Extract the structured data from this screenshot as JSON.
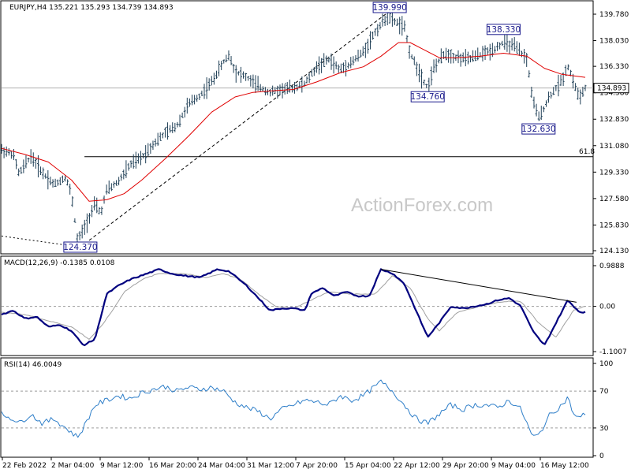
{
  "colors": {
    "price_bars": "#1f3f56",
    "ma_line": "#e00000",
    "trendline": "#000000",
    "fib_line": "#000000",
    "hline": "#b0b0b0",
    "callout_border": "#1a1a8c",
    "macd_line": "#00007f",
    "macd_signal": "#a0a0a0",
    "rsi_line": "#2f7fc9",
    "grid_dash": "#9a9a9a",
    "panel_border": "#000000"
  },
  "chart_data": [
    {
      "type": "line",
      "panel": "price",
      "header": "EURJPY,H4  135.221 135.293 134.739 134.893",
      "watermark": "ActionForex.com",
      "y_ticks": [
        "139.780",
        "138.030",
        "136.330",
        "134.580",
        "132.830",
        "131.080",
        "129.330",
        "127.580",
        "125.830",
        "124.130"
      ],
      "ylim": [
        124.13,
        139.78
      ],
      "last_price": "134.893",
      "close_path": [
        {
          "x": 0,
          "v": 130.8
        },
        {
          "x": 0.02,
          "v": 130.5
        },
        {
          "x": 0.03,
          "v": 129.2
        },
        {
          "x": 0.05,
          "v": 130.4
        },
        {
          "x": 0.07,
          "v": 129.3
        },
        {
          "x": 0.09,
          "v": 128.5
        },
        {
          "x": 0.11,
          "v": 129.0
        },
        {
          "x": 0.12,
          "v": 127.8
        },
        {
          "x": 0.13,
          "v": 124.8
        },
        {
          "x": 0.14,
          "v": 125.5
        },
        {
          "x": 0.16,
          "v": 127.2
        },
        {
          "x": 0.17,
          "v": 126.6
        },
        {
          "x": 0.18,
          "v": 128.1
        },
        {
          "x": 0.2,
          "v": 128.7
        },
        {
          "x": 0.22,
          "v": 129.8
        },
        {
          "x": 0.24,
          "v": 130.3
        },
        {
          "x": 0.26,
          "v": 131.2
        },
        {
          "x": 0.28,
          "v": 131.9
        },
        {
          "x": 0.3,
          "v": 132.4
        },
        {
          "x": 0.32,
          "v": 133.8
        },
        {
          "x": 0.34,
          "v": 134.4
        },
        {
          "x": 0.36,
          "v": 135.3
        },
        {
          "x": 0.38,
          "v": 136.6
        },
        {
          "x": 0.39,
          "v": 137.1
        },
        {
          "x": 0.4,
          "v": 136.0
        },
        {
          "x": 0.42,
          "v": 135.6
        },
        {
          "x": 0.44,
          "v": 135.0
        },
        {
          "x": 0.46,
          "v": 134.6
        },
        {
          "x": 0.48,
          "v": 134.8
        },
        {
          "x": 0.5,
          "v": 134.9
        },
        {
          "x": 0.52,
          "v": 135.2
        },
        {
          "x": 0.54,
          "v": 136.3
        },
        {
          "x": 0.56,
          "v": 136.8
        },
        {
          "x": 0.58,
          "v": 136.1
        },
        {
          "x": 0.6,
          "v": 136.6
        },
        {
          "x": 0.62,
          "v": 137.3
        },
        {
          "x": 0.64,
          "v": 138.6
        },
        {
          "x": 0.66,
          "v": 139.6
        },
        {
          "x": 0.67,
          "v": 139.4
        },
        {
          "x": 0.69,
          "v": 138.9
        },
        {
          "x": 0.7,
          "v": 137.2
        },
        {
          "x": 0.72,
          "v": 135.6
        },
        {
          "x": 0.73,
          "v": 134.9
        },
        {
          "x": 0.74,
          "v": 136.2
        },
        {
          "x": 0.76,
          "v": 137.2
        },
        {
          "x": 0.78,
          "v": 136.9
        },
        {
          "x": 0.8,
          "v": 136.8
        },
        {
          "x": 0.82,
          "v": 137.1
        },
        {
          "x": 0.84,
          "v": 137.4
        },
        {
          "x": 0.86,
          "v": 137.9
        },
        {
          "x": 0.88,
          "v": 137.6
        },
        {
          "x": 0.9,
          "v": 136.8
        },
        {
          "x": 0.91,
          "v": 134.1
        },
        {
          "x": 0.92,
          "v": 132.9
        },
        {
          "x": 0.94,
          "v": 134.4
        },
        {
          "x": 0.96,
          "v": 135.4
        },
        {
          "x": 0.97,
          "v": 136.4
        },
        {
          "x": 0.98,
          "v": 135.3
        },
        {
          "x": 0.99,
          "v": 134.2
        },
        {
          "x": 1.0,
          "v": 134.9
        }
      ],
      "ma_path": [
        {
          "x": 0,
          "v": 130.9
        },
        {
          "x": 0.04,
          "v": 130.5
        },
        {
          "x": 0.08,
          "v": 130.0
        },
        {
          "x": 0.12,
          "v": 128.8
        },
        {
          "x": 0.15,
          "v": 127.4
        },
        {
          "x": 0.18,
          "v": 127.5
        },
        {
          "x": 0.21,
          "v": 127.9
        },
        {
          "x": 0.24,
          "v": 128.8
        },
        {
          "x": 0.28,
          "v": 130.2
        },
        {
          "x": 0.32,
          "v": 131.7
        },
        {
          "x": 0.36,
          "v": 133.3
        },
        {
          "x": 0.4,
          "v": 134.3
        },
        {
          "x": 0.43,
          "v": 134.6
        },
        {
          "x": 0.46,
          "v": 134.7
        },
        {
          "x": 0.5,
          "v": 134.8
        },
        {
          "x": 0.54,
          "v": 135.3
        },
        {
          "x": 0.58,
          "v": 135.9
        },
        {
          "x": 0.62,
          "v": 136.3
        },
        {
          "x": 0.65,
          "v": 137.0
        },
        {
          "x": 0.68,
          "v": 137.9
        },
        {
          "x": 0.7,
          "v": 137.9
        },
        {
          "x": 0.72,
          "v": 137.5
        },
        {
          "x": 0.75,
          "v": 136.9
        },
        {
          "x": 0.78,
          "v": 136.9
        },
        {
          "x": 0.82,
          "v": 137.0
        },
        {
          "x": 0.86,
          "v": 137.2
        },
        {
          "x": 0.9,
          "v": 137.0
        },
        {
          "x": 0.93,
          "v": 136.2
        },
        {
          "x": 0.96,
          "v": 135.8
        },
        {
          "x": 1.0,
          "v": 135.6
        }
      ],
      "callouts": [
        {
          "label": "124.370",
          "x": 0.135,
          "v": 124.37,
          "side": "below"
        },
        {
          "label": "139.990",
          "x": 0.665,
          "v": 139.99,
          "side": "above"
        },
        {
          "label": "134.760",
          "x": 0.73,
          "v": 134.76,
          "side": "below"
        },
        {
          "label": "138.330",
          "x": 0.86,
          "v": 138.33,
          "side": "above"
        },
        {
          "label": "132.630",
          "x": 0.92,
          "v": 132.63,
          "side": "below"
        }
      ],
      "fib_level": {
        "label": "61.8",
        "v": 130.35
      },
      "hline_value": 134.893,
      "trendline": {
        "from": {
          "x": 0.135,
          "v": 124.37
        },
        "to": {
          "x": 0.665,
          "v": 139.99
        }
      },
      "lead_dashed": {
        "from": {
          "x": 0,
          "v": 125.1
        },
        "to": {
          "x": 0.135,
          "v": 124.37
        }
      }
    },
    {
      "type": "line",
      "panel": "macd",
      "header": "MACD(12,26,9) -0.1385 0.0108",
      "y_ticks": [
        "0.9888",
        "0.00",
        "-1.1007"
      ],
      "ylim": [
        -1.1007,
        0.9888
      ],
      "macd_path": [
        {
          "x": 0,
          "v": -0.2
        },
        {
          "x": 0.02,
          "v": -0.1
        },
        {
          "x": 0.04,
          "v": -0.3
        },
        {
          "x": 0.06,
          "v": -0.25
        },
        {
          "x": 0.08,
          "v": -0.5
        },
        {
          "x": 0.1,
          "v": -0.45
        },
        {
          "x": 0.12,
          "v": -0.6
        },
        {
          "x": 0.14,
          "v": -0.95
        },
        {
          "x": 0.16,
          "v": -0.8
        },
        {
          "x": 0.18,
          "v": 0.3
        },
        {
          "x": 0.2,
          "v": 0.5
        },
        {
          "x": 0.22,
          "v": 0.65
        },
        {
          "x": 0.24,
          "v": 0.75
        },
        {
          "x": 0.27,
          "v": 0.9
        },
        {
          "x": 0.29,
          "v": 0.8
        },
        {
          "x": 0.31,
          "v": 0.75
        },
        {
          "x": 0.34,
          "v": 0.7
        },
        {
          "x": 0.37,
          "v": 0.9
        },
        {
          "x": 0.39,
          "v": 0.85
        },
        {
          "x": 0.42,
          "v": 0.5
        },
        {
          "x": 0.44,
          "v": 0.2
        },
        {
          "x": 0.46,
          "v": -0.1
        },
        {
          "x": 0.48,
          "v": -0.05
        },
        {
          "x": 0.5,
          "v": -0.05
        },
        {
          "x": 0.52,
          "v": -0.1
        },
        {
          "x": 0.53,
          "v": 0.3
        },
        {
          "x": 0.55,
          "v": 0.45
        },
        {
          "x": 0.57,
          "v": 0.25
        },
        {
          "x": 0.59,
          "v": 0.35
        },
        {
          "x": 0.61,
          "v": 0.25
        },
        {
          "x": 0.63,
          "v": 0.25
        },
        {
          "x": 0.65,
          "v": 0.9
        },
        {
          "x": 0.67,
          "v": 0.8
        },
        {
          "x": 0.69,
          "v": 0.55
        },
        {
          "x": 0.71,
          "v": -0.1
        },
        {
          "x": 0.73,
          "v": -0.75
        },
        {
          "x": 0.75,
          "v": -0.4
        },
        {
          "x": 0.77,
          "v": 0.0
        },
        {
          "x": 0.79,
          "v": -0.05
        },
        {
          "x": 0.81,
          "v": 0.0
        },
        {
          "x": 0.83,
          "v": 0.05
        },
        {
          "x": 0.85,
          "v": 0.15
        },
        {
          "x": 0.87,
          "v": 0.2
        },
        {
          "x": 0.89,
          "v": 0.0
        },
        {
          "x": 0.91,
          "v": -0.6
        },
        {
          "x": 0.93,
          "v": -0.95
        },
        {
          "x": 0.95,
          "v": -0.4
        },
        {
          "x": 0.97,
          "v": 0.15
        },
        {
          "x": 0.99,
          "v": -0.14
        },
        {
          "x": 1.0,
          "v": -0.14
        }
      ],
      "signal_path": [
        {
          "x": 0,
          "v": -0.15
        },
        {
          "x": 0.04,
          "v": -0.2
        },
        {
          "x": 0.08,
          "v": -0.35
        },
        {
          "x": 0.12,
          "v": -0.5
        },
        {
          "x": 0.15,
          "v": -0.8
        },
        {
          "x": 0.17,
          "v": -0.5
        },
        {
          "x": 0.19,
          "v": -0.1
        },
        {
          "x": 0.21,
          "v": 0.35
        },
        {
          "x": 0.24,
          "v": 0.65
        },
        {
          "x": 0.27,
          "v": 0.8
        },
        {
          "x": 0.31,
          "v": 0.8
        },
        {
          "x": 0.35,
          "v": 0.7
        },
        {
          "x": 0.38,
          "v": 0.8
        },
        {
          "x": 0.41,
          "v": 0.65
        },
        {
          "x": 0.44,
          "v": 0.3
        },
        {
          "x": 0.47,
          "v": 0.0
        },
        {
          "x": 0.5,
          "v": -0.05
        },
        {
          "x": 0.53,
          "v": 0.15
        },
        {
          "x": 0.56,
          "v": 0.35
        },
        {
          "x": 0.6,
          "v": 0.3
        },
        {
          "x": 0.64,
          "v": 0.3
        },
        {
          "x": 0.67,
          "v": 0.75
        },
        {
          "x": 0.7,
          "v": 0.45
        },
        {
          "x": 0.73,
          "v": -0.3
        },
        {
          "x": 0.75,
          "v": -0.6
        },
        {
          "x": 0.78,
          "v": -0.15
        },
        {
          "x": 0.82,
          "v": 0.0
        },
        {
          "x": 0.86,
          "v": 0.12
        },
        {
          "x": 0.89,
          "v": 0.12
        },
        {
          "x": 0.92,
          "v": -0.4
        },
        {
          "x": 0.95,
          "v": -0.75
        },
        {
          "x": 0.98,
          "v": -0.1
        },
        {
          "x": 1.0,
          "v": 0.01
        }
      ],
      "trendline": {
        "from": {
          "x": 0.65,
          "v": 0.9
        },
        "to": {
          "x": 0.985,
          "v": 0.1
        }
      }
    },
    {
      "type": "line",
      "panel": "rsi",
      "header": "RSI(14) 46.0049",
      "y_ticks": [
        "100",
        "70",
        "30",
        "0"
      ],
      "ylim": [
        0,
        100
      ],
      "levels": [
        70,
        30
      ],
      "rsi_path": [
        {
          "x": 0,
          "v": 45
        },
        {
          "x": 0.02,
          "v": 40
        },
        {
          "x": 0.03,
          "v": 35
        },
        {
          "x": 0.05,
          "v": 45
        },
        {
          "x": 0.07,
          "v": 35
        },
        {
          "x": 0.09,
          "v": 40
        },
        {
          "x": 0.11,
          "v": 30
        },
        {
          "x": 0.13,
          "v": 20
        },
        {
          "x": 0.14,
          "v": 30
        },
        {
          "x": 0.16,
          "v": 55
        },
        {
          "x": 0.18,
          "v": 60
        },
        {
          "x": 0.2,
          "v": 65
        },
        {
          "x": 0.22,
          "v": 62
        },
        {
          "x": 0.24,
          "v": 68
        },
        {
          "x": 0.26,
          "v": 72
        },
        {
          "x": 0.28,
          "v": 75
        },
        {
          "x": 0.3,
          "v": 70
        },
        {
          "x": 0.32,
          "v": 74
        },
        {
          "x": 0.34,
          "v": 72
        },
        {
          "x": 0.36,
          "v": 74
        },
        {
          "x": 0.38,
          "v": 70
        },
        {
          "x": 0.4,
          "v": 58
        },
        {
          "x": 0.42,
          "v": 52
        },
        {
          "x": 0.44,
          "v": 48
        },
        {
          "x": 0.46,
          "v": 40
        },
        {
          "x": 0.48,
          "v": 50
        },
        {
          "x": 0.5,
          "v": 55
        },
        {
          "x": 0.52,
          "v": 60
        },
        {
          "x": 0.54,
          "v": 58
        },
        {
          "x": 0.56,
          "v": 55
        },
        {
          "x": 0.58,
          "v": 65
        },
        {
          "x": 0.6,
          "v": 60
        },
        {
          "x": 0.62,
          "v": 65
        },
        {
          "x": 0.64,
          "v": 75
        },
        {
          "x": 0.65,
          "v": 80
        },
        {
          "x": 0.67,
          "v": 70
        },
        {
          "x": 0.69,
          "v": 55
        },
        {
          "x": 0.71,
          "v": 40
        },
        {
          "x": 0.73,
          "v": 35
        },
        {
          "x": 0.75,
          "v": 45
        },
        {
          "x": 0.77,
          "v": 55
        },
        {
          "x": 0.79,
          "v": 50
        },
        {
          "x": 0.81,
          "v": 55
        },
        {
          "x": 0.83,
          "v": 55
        },
        {
          "x": 0.85,
          "v": 52
        },
        {
          "x": 0.87,
          "v": 60
        },
        {
          "x": 0.89,
          "v": 50
        },
        {
          "x": 0.91,
          "v": 20
        },
        {
          "x": 0.92,
          "v": 22
        },
        {
          "x": 0.94,
          "v": 45
        },
        {
          "x": 0.96,
          "v": 55
        },
        {
          "x": 0.97,
          "v": 63
        },
        {
          "x": 0.98,
          "v": 45
        },
        {
          "x": 0.99,
          "v": 40
        },
        {
          "x": 1.0,
          "v": 46
        }
      ]
    }
  ],
  "x_axis": {
    "labels": [
      "22 Feb 2022",
      "2 Mar 04:00",
      "9 Mar 12:00",
      "16 Mar 20:00",
      "24 Mar 04:00",
      "31 Mar 12:00",
      "7 Apr 20:00",
      "15 Apr 04:00",
      "22 Apr 12:00",
      "29 Apr 20:00",
      "9 May 04:00",
      "16 May 12:00"
    ]
  }
}
